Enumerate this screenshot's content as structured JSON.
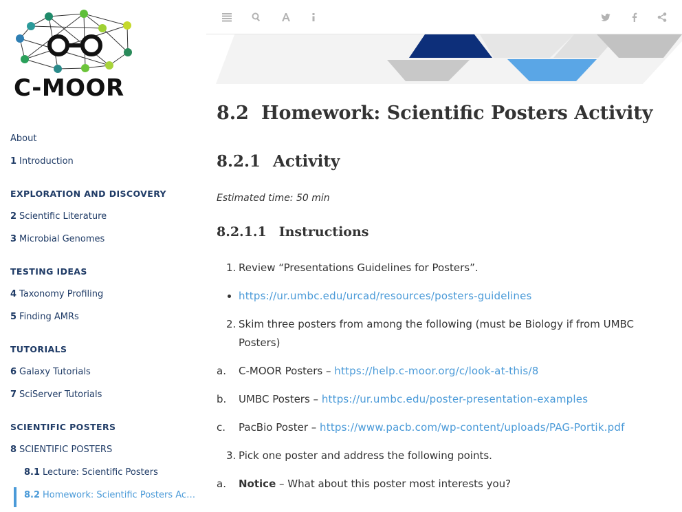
{
  "logo": {
    "text": "C-MOOR"
  },
  "sidebar": {
    "about": "About",
    "intro": {
      "num": "1",
      "label": "Introduction"
    },
    "sections": [
      {
        "header": "EXPLORATION AND DISCOVERY",
        "items": [
          {
            "num": "2",
            "label": "Scientific Literature"
          },
          {
            "num": "3",
            "label": "Microbial Genomes"
          }
        ]
      },
      {
        "header": "TESTING IDEAS",
        "items": [
          {
            "num": "4",
            "label": "Taxonomy Profiling"
          },
          {
            "num": "5",
            "label": "Finding AMRs"
          }
        ]
      },
      {
        "header": "TUTORIALS",
        "items": [
          {
            "num": "6",
            "label": "Galaxy Tutorials"
          },
          {
            "num": "7",
            "label": "SciServer Tutorials"
          }
        ]
      },
      {
        "header": "SCIENTIFIC POSTERS",
        "items": [
          {
            "num": "8",
            "label": "SCIENTIFIC POSTERS"
          }
        ]
      }
    ],
    "subitems": [
      {
        "num": "8.1",
        "label": "Lecture: Scientific Posters"
      },
      {
        "num": "8.2",
        "label": "Homework: Scientific Posters Acti..."
      }
    ]
  },
  "toolbar": {
    "left_icons": [
      "sidebar-toggle-icon",
      "search-icon",
      "font-settings-icon",
      "info-icon"
    ],
    "right_icons": [
      "twitter-icon",
      "facebook-icon",
      "share-icon"
    ],
    "icon_color": "#b3b3b3"
  },
  "content": {
    "title_num": "8.2",
    "title": "Homework: Scientific Posters Activity",
    "section_num": "8.2.1",
    "section": "Activity",
    "estimated": "Estimated time: 50 min",
    "subsection_num": "8.2.1.1",
    "subsection": "Instructions",
    "steps": [
      {
        "marker": "1.",
        "text": "Review “Presentations Guidelines for Posters”."
      },
      {
        "marker": "•",
        "link": "https://ur.umbc.edu/urcad/resources/posters-guidelines"
      },
      {
        "marker": "2.",
        "text": "Skim three posters from among the following (must be Biology if from UMBC Posters)"
      },
      {
        "marker": "a.",
        "text": "C-MOOR Posters – ",
        "link": "https://help.c-moor.org/c/look-at-this/8"
      },
      {
        "marker": "b.",
        "text": "UMBC Posters – ",
        "link": "https://ur.umbc.edu/poster-presentation-examples"
      },
      {
        "marker": "c.",
        "text": "PacBio Poster – ",
        "link": "https://www.pacb.com/wp-content/uploads/PAG-Portik.pdf"
      },
      {
        "marker": "3.",
        "text": "Pick one poster and address the following points."
      },
      {
        "marker": "a.",
        "bold": "Notice",
        "text": " – What about this poster most interests you?"
      }
    ]
  },
  "colors": {
    "accent": "#4a9ad8",
    "nav": "#1f3b66",
    "banner_navy": "#0d2f7a",
    "banner_blue": "#5aa6e6"
  }
}
